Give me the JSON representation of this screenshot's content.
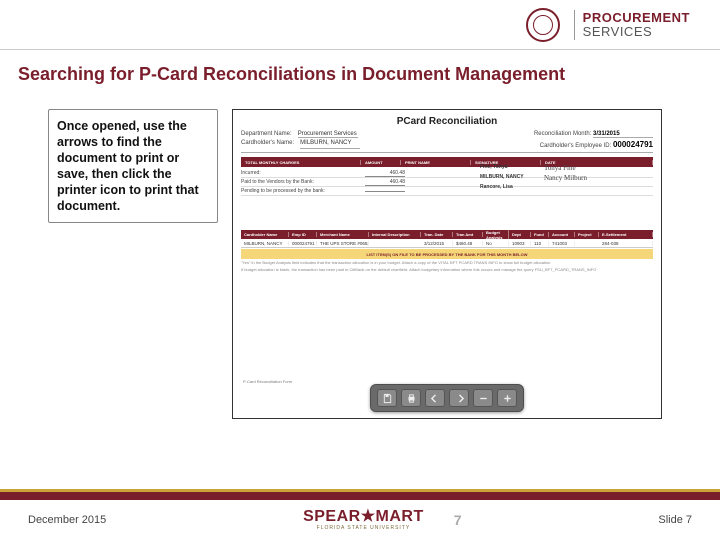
{
  "header": {
    "brand_line1": "PROCUREMENT",
    "brand_line2": "SERVICES"
  },
  "title": "Searching for P-Card Reconciliations in Document Management",
  "note": "Once opened, use the arrows to find the document to print or save, then click the printer icon to print that document.",
  "doc": {
    "title": "PCard Reconciliation",
    "dept_label": "Department Name:",
    "dept_value": "Procurement Services",
    "rmonth_label": "Reconciliation Month:",
    "rmonth_value": "3/31/2015",
    "holder_label": "Cardholder's Name:",
    "holder_value": "MILBURN, NANCY",
    "empid_label": "Cardholder's Employee ID:",
    "empid_value": "000024791",
    "bar1": {
      "c1": "TOTAL MONTHLY CHARGES",
      "c2": "AMOUNT",
      "c3": "PRINT NAME",
      "c4": "SIGNATURE",
      "c5": "DATE"
    },
    "rows": [
      {
        "label": "Incurred:",
        "amt": "460.48"
      },
      {
        "label": "Paid to the Vendors by the Bank:",
        "amt": "460.48"
      },
      {
        "label": "Pending to be processed by the bank:",
        "amt": ""
      }
    ],
    "sigs": [
      {
        "name": "Fine, Tonya",
        "role": "",
        "sig": "Tonya Fine"
      },
      {
        "name": "MILBURN, NANCY",
        "role": "",
        "sig": "Nancy Milburn"
      },
      {
        "name": "Rancore, Lisa",
        "role": "",
        "sig": ""
      }
    ],
    "bar2": [
      "Cardholder Name",
      "Emp ID",
      "Merchant Name",
      "Internal Description",
      "Tran. Date",
      "Tran Amt",
      "Budget Analysis",
      "Dept",
      "Fund",
      "Account",
      "Project",
      "E-Settlement"
    ],
    "data": [
      "MILBURN, NANCY",
      "000024791",
      "THE UPS STORE #0652",
      "",
      "3/12/2015",
      "$460.48",
      "No",
      "10903",
      "110",
      "741003",
      "",
      "284-038"
    ],
    "ystrip": "LIST ITEM(S) ON FILE TO BE PROCESSED BY THE BANK FOR THIS MONTH BELOW",
    "fine1": "\"Yes\" in the Budget Analysis field indicates that the transaction allocation is in your budget. Attach a copy of the VITAL BFT PCARD TRANS INFO to show full budget allocation",
    "fine2": "If budget allocation is blank, the transaction has been paid to CitiBank on the default chartfield. Attach budgetary information where this occurs and manage the query FSU_BFT_PCARD_TRANS_INFO",
    "footform": "P-Card Reconciliation Form"
  },
  "toolbar": {
    "save": "save-icon",
    "print": "print-icon",
    "prev": "prev-icon",
    "next": "next-icon",
    "minus": "zoom-out-icon",
    "plus": "zoom-in-icon"
  },
  "footer": {
    "left": "December 2015",
    "logo": "SPEAR★MART",
    "logo_sub": "FLORIDA STATE UNIVERSITY",
    "center": "7",
    "right": "Slide 7"
  }
}
